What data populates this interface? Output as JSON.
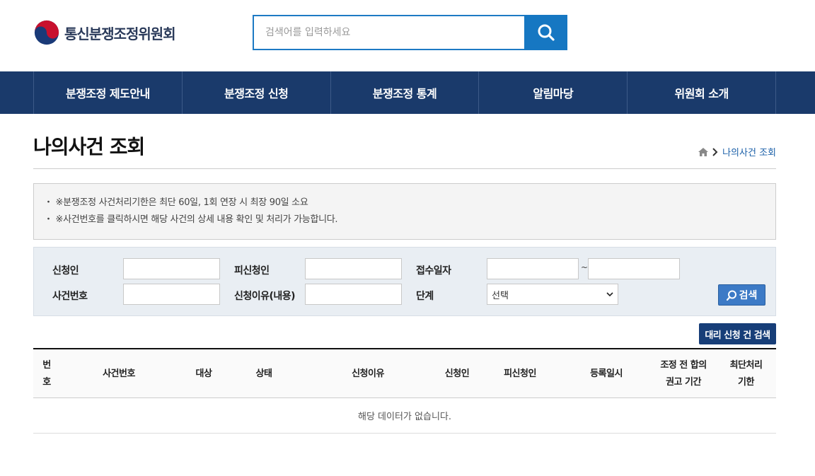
{
  "header": {
    "logo_text": "통신분쟁조정위원회",
    "search_placeholder": "검색어를 입력하세요"
  },
  "nav": {
    "items": [
      {
        "label": "분쟁조정 제도안내"
      },
      {
        "label": "분쟁조정 신청"
      },
      {
        "label": "분쟁조정 통계"
      },
      {
        "label": "알림마당"
      },
      {
        "label": "위원회 소개"
      }
    ]
  },
  "page": {
    "title": "나의사건 조회",
    "breadcrumb_current": "나의사건 조회"
  },
  "notice": {
    "items": [
      "※분쟁조정 사건처리기한은 최단 60일, 1회 연장 시 최장 90일 소요",
      "※사건번호를 클릭하시면 해당 사건의 상세 내용 확인 및 처리가 가능합니다."
    ]
  },
  "form": {
    "applicant_label": "신청인",
    "respondent_label": "피신청인",
    "receipt_date_label": "접수일자",
    "case_number_label": "사건번호",
    "reason_label": "신청이유(내용)",
    "stage_label": "단계",
    "stage_selected": "선택",
    "tilde": "~",
    "search_button": "검색"
  },
  "agent_search_button": "대리 신청 건 검색",
  "table": {
    "headers": {
      "no_1": "번",
      "no_2": "호",
      "case_number": "사건번호",
      "target": "대상",
      "status": "상태",
      "reason": "신청이유",
      "applicant": "신청인",
      "respondent": "피신청인",
      "registered": "등록일시",
      "deadline_pre_1": "조정 전 합의",
      "deadline_pre_2": "권고 기간",
      "deadline_1": "최단처리",
      "deadline_2": "기한"
    },
    "empty_message": "해당 데이터가 없습니다."
  },
  "colors": {
    "nav_bg": "#1a3a6b",
    "accent": "#1677c2",
    "agent_button": "#173e78"
  }
}
